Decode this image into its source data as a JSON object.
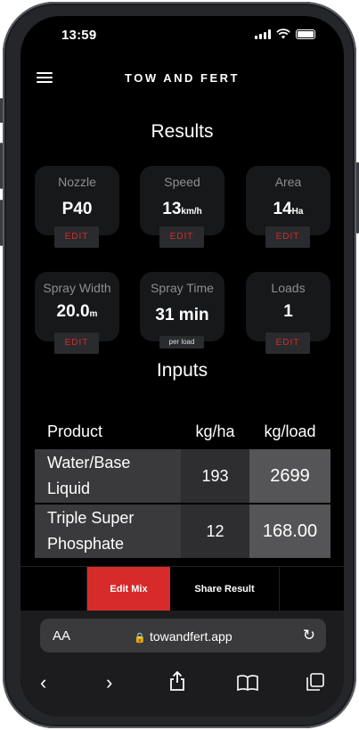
{
  "status": {
    "time": "13:59"
  },
  "header": {
    "brand": "TOW AND FERT"
  },
  "results": {
    "title": "Results",
    "cards": [
      {
        "label": "Nozzle",
        "value": "P40",
        "unit": "",
        "action": "EDIT"
      },
      {
        "label": "Speed",
        "value": "13",
        "unit": "km/h",
        "action": "EDIT"
      },
      {
        "label": "Area",
        "value": "14",
        "unit": "Ha",
        "action": "EDIT"
      },
      {
        "label": "Spray Width",
        "value": "20.0",
        "unit": "m",
        "action": "EDIT"
      },
      {
        "label": "Spray Time",
        "value": "31 min",
        "unit": "",
        "note": "per load"
      },
      {
        "label": "Loads",
        "value": "1",
        "unit": "",
        "action": "EDIT"
      }
    ]
  },
  "inputs": {
    "title": "Inputs",
    "columns": [
      "Product",
      "kg/ha",
      "kg/load"
    ],
    "rows": [
      {
        "product_line1": "Water/Base",
        "product_line2": "Liquid",
        "kg_ha": "193",
        "kg_load": "2699"
      },
      {
        "product_line1": "Triple Super",
        "product_line2": "Phosphate",
        "kg_ha": "12",
        "kg_load": "168.00"
      }
    ]
  },
  "actions": {
    "edit_mix": "Edit Mix",
    "share_result": "Share Result"
  },
  "browser": {
    "aa": "AA",
    "url": "towandfert.app"
  },
  "colors": {
    "accent": "#d72a2a",
    "background": "#000000",
    "card": "#17181a"
  }
}
